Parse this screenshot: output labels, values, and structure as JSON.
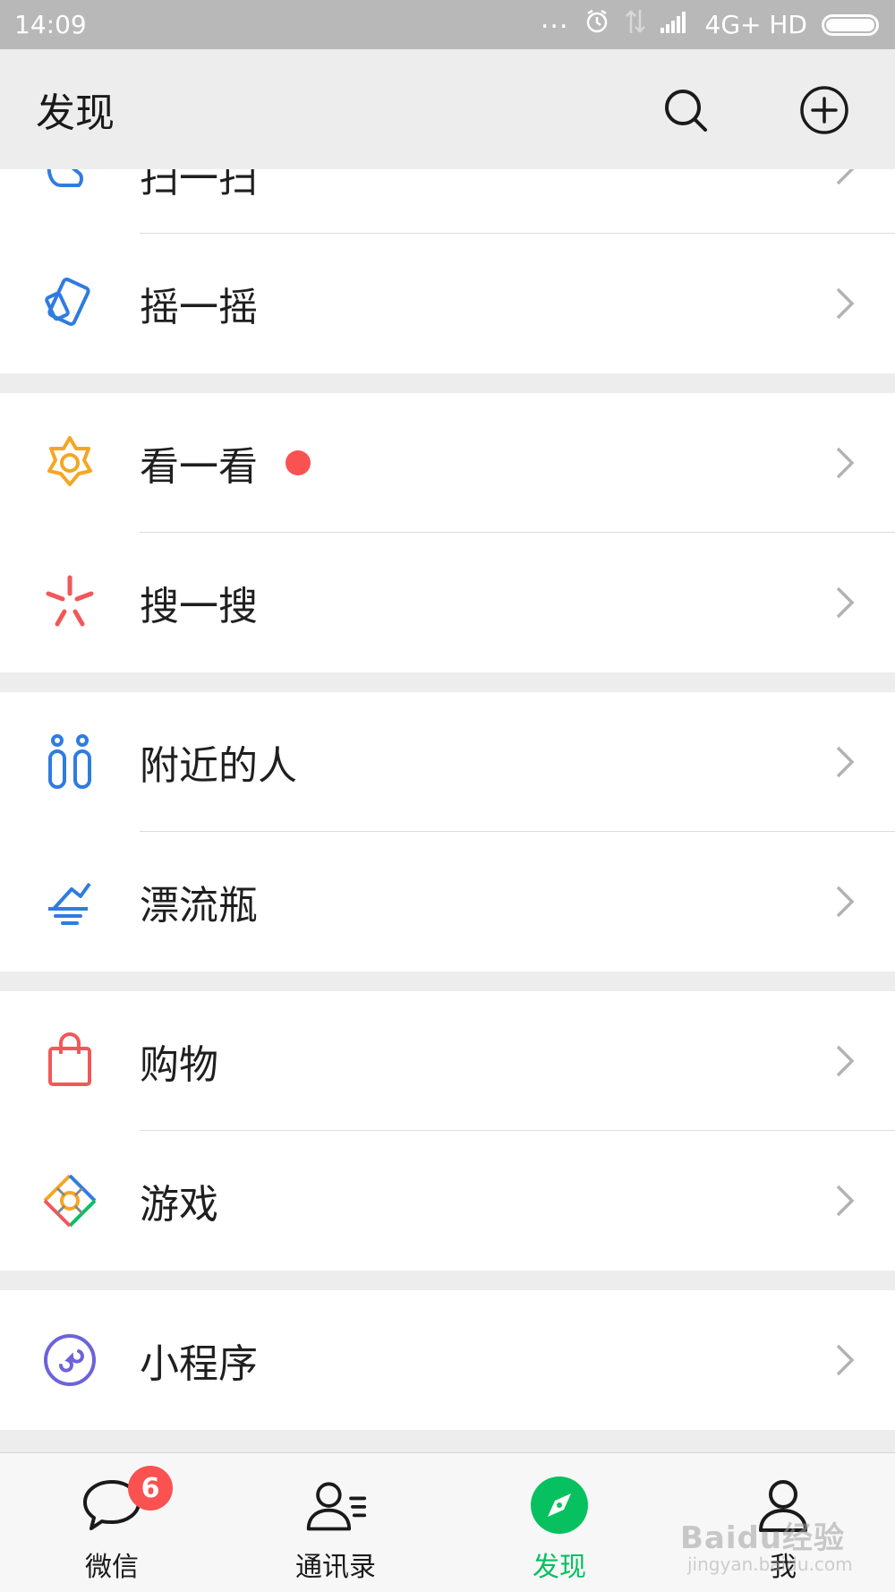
{
  "status_bar": {
    "time": "14:09",
    "dots": "...",
    "network": "4G+ HD"
  },
  "header": {
    "title": "发现"
  },
  "groups": [
    {
      "items": [
        {
          "label": "扫一扫",
          "icon": "scan-icon",
          "clipped": true
        },
        {
          "label": "摇一摇",
          "icon": "shake-icon"
        }
      ]
    },
    {
      "items": [
        {
          "label": "看一看",
          "icon": "top-stories-icon",
          "dot": true
        },
        {
          "label": "搜一搜",
          "icon": "search-star-icon"
        }
      ]
    },
    {
      "items": [
        {
          "label": "附近的人",
          "icon": "people-nearby-icon"
        },
        {
          "label": "漂流瓶",
          "icon": "drift-bottle-icon"
        }
      ]
    },
    {
      "items": [
        {
          "label": "购物",
          "icon": "shopping-bag-icon"
        },
        {
          "label": "游戏",
          "icon": "games-icon"
        }
      ]
    },
    {
      "items": [
        {
          "label": "小程序",
          "icon": "mini-program-icon"
        }
      ]
    }
  ],
  "tabs": [
    {
      "label": "微信",
      "icon": "chat-icon",
      "badge": "6"
    },
    {
      "label": "通讯录",
      "icon": "contacts-icon"
    },
    {
      "label": "发现",
      "icon": "discover-icon",
      "active": true
    },
    {
      "label": "我",
      "icon": "me-icon"
    }
  ],
  "colors": {
    "accent": "#07c160",
    "badge": "#fa5151",
    "blue_icon": "#2f7ce0",
    "orange_icon": "#f5a623",
    "red_icon": "#f2575a",
    "purple_icon": "#6c63d9"
  },
  "watermark": {
    "brand": "Baidu经验",
    "url": "jingyan.baidu.com"
  }
}
